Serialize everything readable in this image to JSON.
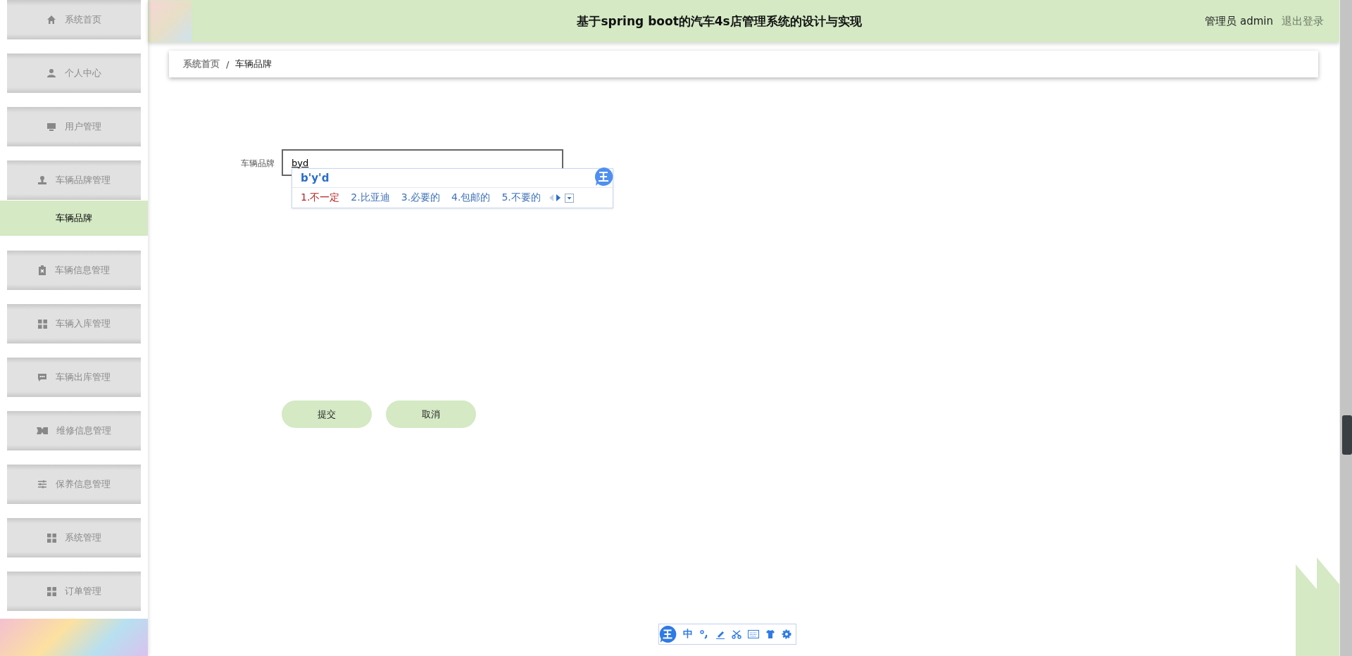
{
  "sidebar": {
    "items": [
      {
        "label": "系统首页",
        "selected": false
      },
      {
        "label": "个人中心",
        "selected": false
      },
      {
        "label": "用户管理",
        "selected": false
      },
      {
        "label": "车辆品牌管理",
        "selected": false,
        "children": [
          {
            "label": "车辆品牌",
            "selected": true
          }
        ]
      },
      {
        "label": "车辆信息管理",
        "selected": false
      },
      {
        "label": "车辆入库管理",
        "selected": false
      },
      {
        "label": "车辆出库管理",
        "selected": false
      },
      {
        "label": "维修信息管理",
        "selected": false
      },
      {
        "label": "保养信息管理",
        "selected": false
      },
      {
        "label": "系统管理",
        "selected": false
      },
      {
        "label": "订单管理",
        "selected": false
      }
    ]
  },
  "header": {
    "title": "基于spring boot的汽车4s店管理系统的设计与实现",
    "user": "管理员 admin",
    "logout": "退出登录"
  },
  "breadcrumb": [
    {
      "label": "系统首页",
      "selected": false
    },
    {
      "label": "车辆品牌",
      "selected": true
    }
  ],
  "breadcrumb_separator": "/",
  "form": {
    "fields": [
      {
        "label": "车辆品牌",
        "value": "byd"
      }
    ],
    "buttons": [
      "提交",
      "取消"
    ]
  },
  "ime_popup": {
    "composition": "b'y'd",
    "candidates": [
      {
        "label": "1.不一定",
        "selected": true
      },
      {
        "label": "2.比亚迪",
        "selected": false
      },
      {
        "label": "3.必要的",
        "selected": false
      },
      {
        "label": "4.包邮的",
        "selected": false
      },
      {
        "label": "5.不要的",
        "selected": false
      }
    ]
  },
  "ime_toolbar": {
    "mode": "中"
  }
}
